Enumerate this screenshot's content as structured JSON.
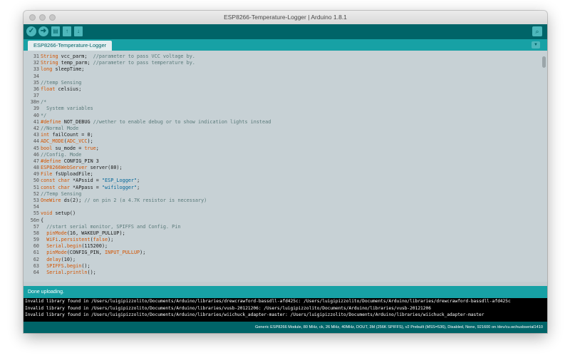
{
  "window": {
    "title": "ESP8266-Temperature-Logger | Arduino 1.8.1"
  },
  "toolbar": {
    "verify_icon": "check-icon",
    "upload_icon": "arrow-right-icon",
    "new_icon": "new-file-icon",
    "open_icon": "arrow-up-icon",
    "save_icon": "arrow-down-icon",
    "serial_icon": "magnifier-icon"
  },
  "tabs": [
    {
      "label": "ESP8266-Temperature-Logger"
    }
  ],
  "tab_menu_icon": "triangle-down-icon",
  "editor": {
    "lines": [
      {
        "n": "31",
        "t": "String vcc_parm;  //parameter to pass VCC voltage by."
      },
      {
        "n": "32",
        "t": "String temp_parm; //parameter to pass temperature by."
      },
      {
        "n": "33",
        "t": "long sleepTime;"
      },
      {
        "n": "34",
        "t": ""
      },
      {
        "n": "35",
        "t": "//temp Sensing"
      },
      {
        "n": "36",
        "t": "float celsius;"
      },
      {
        "n": "37",
        "t": ""
      },
      {
        "n": "38⊟",
        "t": "/*"
      },
      {
        "n": "39",
        "t": "  System variables"
      },
      {
        "n": "40",
        "t": "*/"
      },
      {
        "n": "41",
        "t": "#define NOT_DEBUG //wether to enable debug or to show indication lights instead"
      },
      {
        "n": "42",
        "t": "//Normal Mode"
      },
      {
        "n": "43",
        "t": "int failCount = 0;"
      },
      {
        "n": "44",
        "t": "ADC_MODE(ADC_VCC);"
      },
      {
        "n": "45",
        "t": "bool su_mode = true;"
      },
      {
        "n": "46",
        "t": "//Config. Mode"
      },
      {
        "n": "47",
        "t": "#define CONFIG_PIN 3"
      },
      {
        "n": "48",
        "t": "ESP8266WebServer server(80);"
      },
      {
        "n": "49",
        "t": "File fsUploadFile;"
      },
      {
        "n": "50",
        "t": "const char *APssid = \"ESP_Logger\";"
      },
      {
        "n": "51",
        "t": "const char *APpass = \"wifilogger\";"
      },
      {
        "n": "52",
        "t": "//Temp Sensing"
      },
      {
        "n": "53",
        "t": "OneWire ds(2); // on pin 2 (a 4.7K resistor is necessary)"
      },
      {
        "n": "54",
        "t": ""
      },
      {
        "n": "55",
        "t": "void setup()"
      },
      {
        "n": "56⊟",
        "t": "{"
      },
      {
        "n": "57",
        "t": "  //start serial monitor, SPIFFS and Config. Pin"
      },
      {
        "n": "58",
        "t": "  pinMode(16, WAKEUP_PULLUP);"
      },
      {
        "n": "59",
        "t": "  WiFi.persistent(false);"
      },
      {
        "n": "60",
        "t": "  Serial.begin(115200);"
      },
      {
        "n": "61",
        "t": "  pinMode(CONFIG_PIN, INPUT_PULLUP);"
      },
      {
        "n": "62",
        "t": "  delay(10);"
      },
      {
        "n": "63",
        "t": "  SPIFFS.begin();"
      },
      {
        "n": "64",
        "t": "  Serial.println();"
      }
    ]
  },
  "status": {
    "message": "Done uploading."
  },
  "console": {
    "lines": [
      "Invalid library found in /Users/luigipizzolito/Documents/Arduino/libraries/drewcrawford-bassdll-afd425c: /Users/luigipizzolito/Documents/Arduino/libraries/drewcrawford-bassdll-afd425c",
      "Invalid library found in /Users/luigipizzolito/Documents/Arduino/libraries/vusb-20121206: /Users/luigipizzolito/Documents/Arduino/libraries/vusb-20121206",
      "Invalid library found in /Users/luigipizzolito/Documents/Arduino/libraries/wiichuck_adapter-master: /Users/luigipizzolito/Documents/Arduino/libraries/wiichuck_adapter-master"
    ]
  },
  "footer": {
    "board": "Generic ESP8266 Module, 80 MHz, ck, 26 MHz, 40MHz, DOUT, 3M (256K SPIFFS), v2 Prebuilt (MSS=536), Disabled, None, 921600 on /dev/cu.wchusbserial1410"
  },
  "colors": {
    "toolbar": "#006468",
    "tabbar": "#17a1a5",
    "editor_bg": "#c7d1d5",
    "keyword": "#d35400",
    "comment": "#5a7a7a"
  }
}
